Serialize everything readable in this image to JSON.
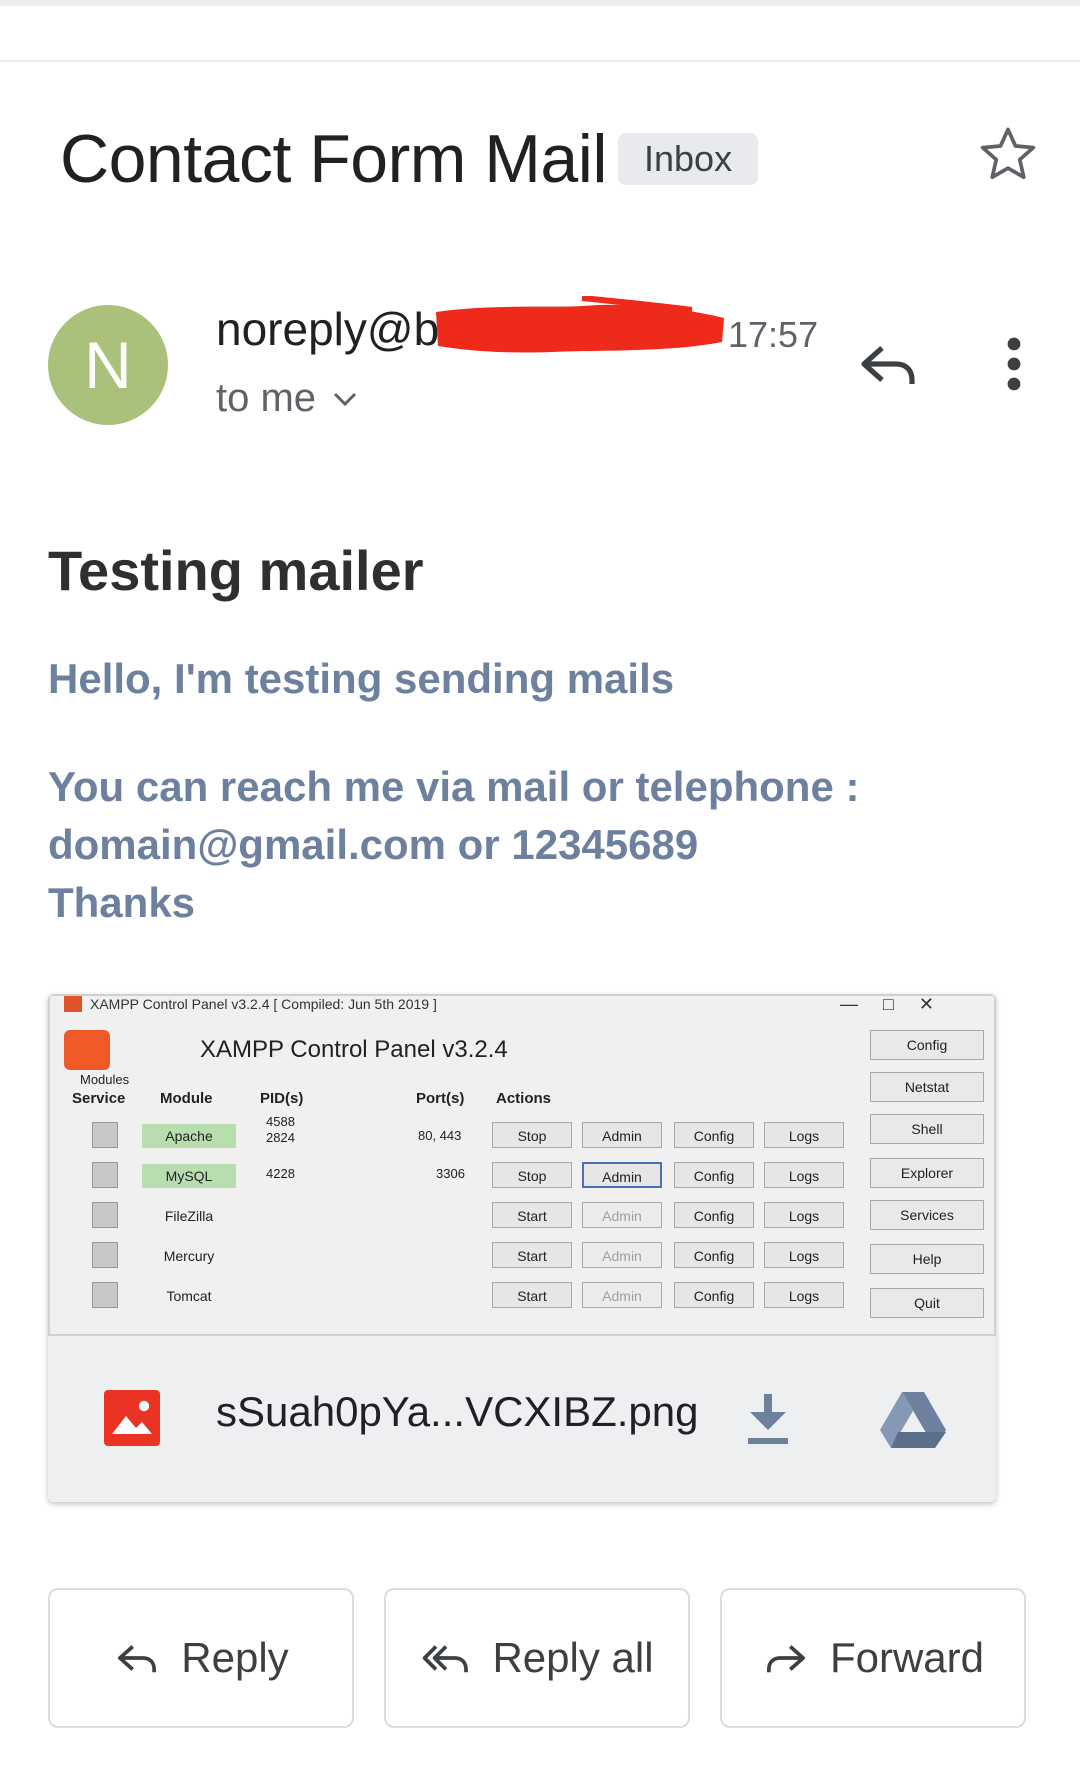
{
  "email": {
    "subject": "Contact Form Mail",
    "label": "Inbox",
    "sender_initial": "N",
    "sender_visible": "noreply@b",
    "time": "17:57",
    "recipient": "to me",
    "title": "Testing mailer",
    "body": [
      "Hello, I'm testing sending mails",
      "You can reach me via mail or telephone :",
      "domain@gmail.com or 12345689",
      "Thanks"
    ]
  },
  "attachment": {
    "file_name": "sSuah0pYa...VCXIBZ.png",
    "thumbnail": {
      "window_title": "XAMPP Control Panel v3.2.4   [ Compiled: Jun 5th 2019 ]",
      "heading": "XAMPP Control Panel v3.2.4",
      "col_modules": "Modules",
      "col_service": "Service",
      "col_module": "Module",
      "col_pids": "PID(s)",
      "col_ports": "Port(s)",
      "col_actions": "Actions",
      "rows": [
        {
          "module": "Apache",
          "pid": "4588\n2824",
          "port": "80, 443",
          "action": "Stop",
          "admin": "Admin",
          "config": "Config",
          "logs": "Logs"
        },
        {
          "module": "MySQL",
          "pid": "4228",
          "port": "3306",
          "action": "Stop",
          "admin": "Admin",
          "config": "Config",
          "logs": "Logs"
        },
        {
          "module": "FileZilla",
          "pid": "",
          "port": "",
          "action": "Start",
          "admin": "Admin",
          "config": "Config",
          "logs": "Logs"
        },
        {
          "module": "Mercury",
          "pid": "",
          "port": "",
          "action": "Start",
          "admin": "Admin",
          "config": "Config",
          "logs": "Logs"
        },
        {
          "module": "Tomcat",
          "pid": "",
          "port": "",
          "action": "Start",
          "admin": "Admin",
          "config": "Config",
          "logs": "Logs"
        }
      ],
      "side_buttons": [
        "Config",
        "Netstat",
        "Shell",
        "Explorer",
        "Services",
        "Help",
        "Quit"
      ]
    }
  },
  "actions": {
    "reply": "Reply",
    "reply_all": "Reply all",
    "forward": "Forward"
  },
  "colors": {
    "avatar": "#a9c17a",
    "body_text": "#6d809e",
    "redaction": "#ee2a1a"
  }
}
